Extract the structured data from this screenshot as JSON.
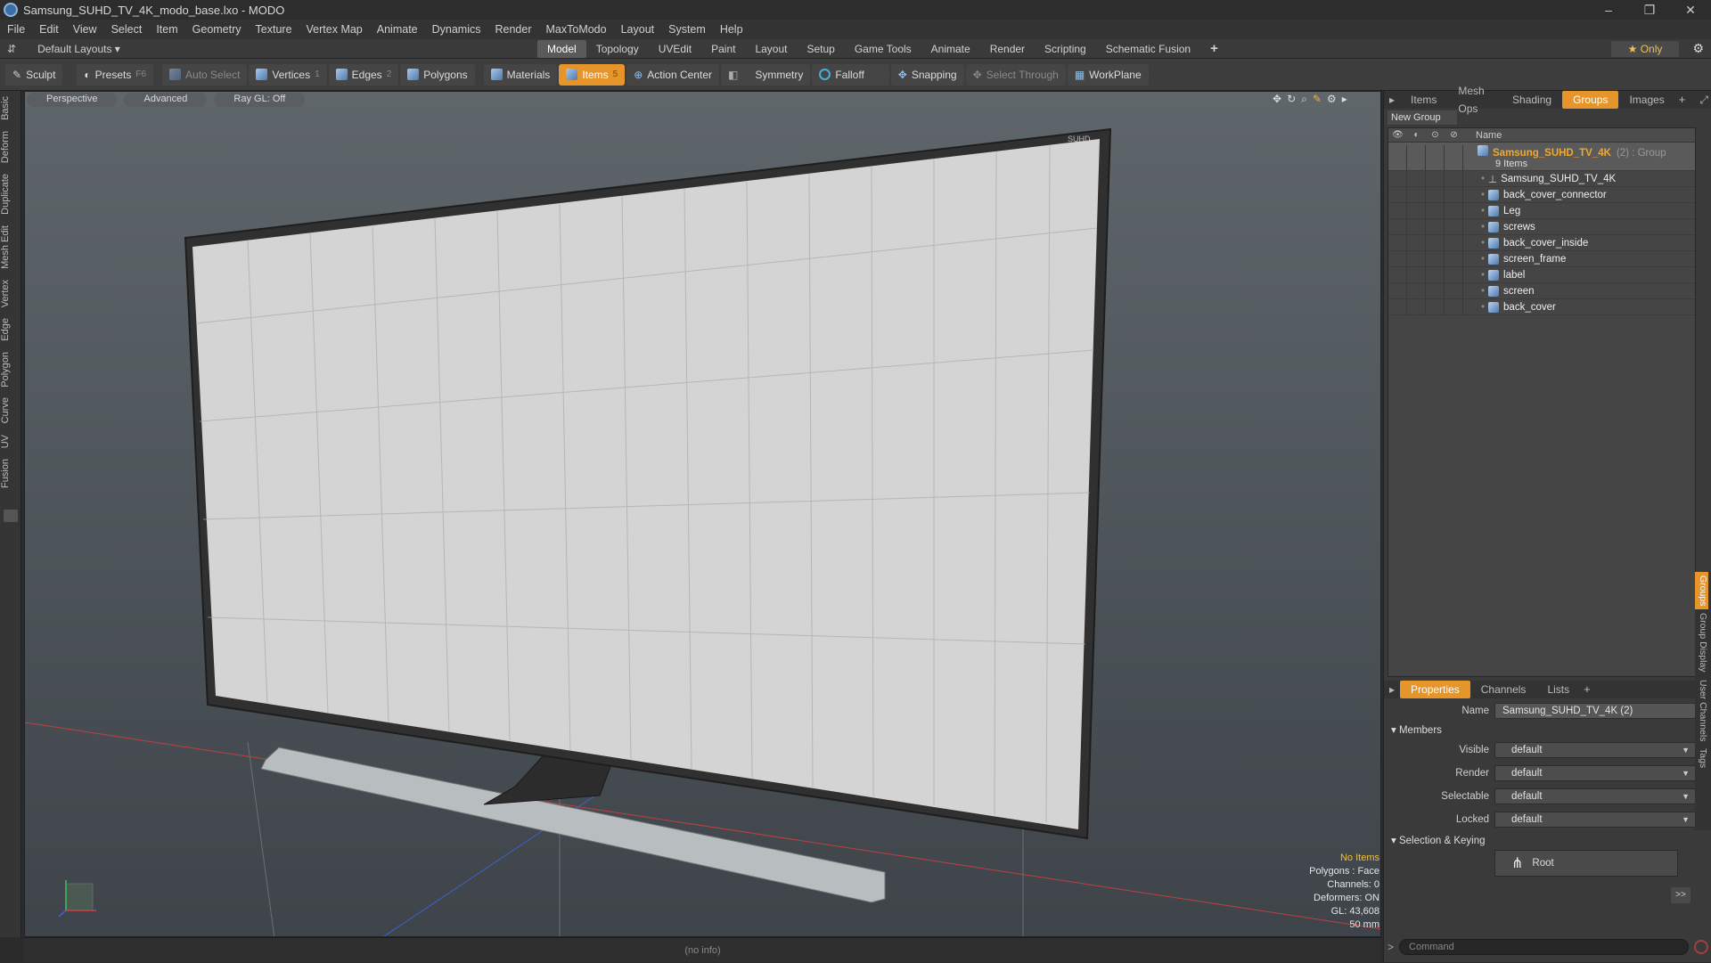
{
  "window": {
    "title": "Samsung_SUHD_TV_4K_modo_base.lxo - MODO",
    "controls": [
      "–",
      "❐",
      "✕"
    ]
  },
  "menu": [
    "File",
    "Edit",
    "View",
    "Select",
    "Item",
    "Geometry",
    "Texture",
    "Vertex Map",
    "Animate",
    "Dynamics",
    "Render",
    "MaxToModo",
    "Layout",
    "System",
    "Help"
  ],
  "layout_bar": {
    "layouts_label": "Default Layouts ▾",
    "tabs": [
      "Model",
      "Topology",
      "UVEdit",
      "Paint",
      "Layout",
      "Setup",
      "Game Tools",
      "Animate",
      "Render",
      "Scripting",
      "Schematic Fusion"
    ],
    "active_tab": "Model",
    "add": "+",
    "only_label": "★  Only"
  },
  "toolbar": {
    "sculpt": "Sculpt",
    "presets": "Presets",
    "presets_key": "F6",
    "auto_select": "Auto Select",
    "vertices": "Vertices",
    "vertices_count": "1",
    "edges": "Edges",
    "edges_count": "2",
    "polygons": "Polygons",
    "materials": "Materials",
    "items": "Items",
    "items_count": "5",
    "action_center": "Action Center",
    "symmetry": "Symmetry",
    "falloff": "Falloff",
    "snapping": "Snapping",
    "select_through": "Select Through",
    "workplane": "WorkPlane"
  },
  "left_tabs": [
    "Basic",
    "Deform",
    "Duplicate",
    "Mesh Edit",
    "Vertex",
    "Edge",
    "Polygon",
    "Curve",
    "UV",
    "Fusion"
  ],
  "viewport": {
    "view_mode": "Perspective",
    "shading": "Advanced",
    "raygl": "Ray GL: Off",
    "tv_badge": "SUHD",
    "info": {
      "items": "No Items",
      "polygons": "Polygons : Face",
      "channels": "Channels: 0",
      "deformers": "Deformers: ON",
      "gl": "GL: 43,608",
      "lens": "50 mm"
    },
    "status": "(no info)"
  },
  "panel_tabs": [
    "Items",
    "Mesh Ops",
    "Shading",
    "Groups",
    "Images"
  ],
  "panel_active": "Groups",
  "groups": {
    "new_group": "New Group",
    "name_col": "Name",
    "group_name": "Samsung_SUHD_TV_4K",
    "group_tag": "(2) : Group",
    "group_count": "9 Items",
    "members": [
      "Samsung_SUHD_TV_4K",
      "back_cover_connector",
      "Leg",
      "screws",
      "back_cover_inside",
      "screen_frame",
      "label",
      "screen",
      "back_cover"
    ]
  },
  "properties": {
    "tabs": [
      "Properties",
      "Channels",
      "Lists"
    ],
    "active": "Properties",
    "name_label": "Name",
    "name_value": "Samsung_SUHD_TV_4K (2)",
    "members_section": "Members",
    "visible_label": "Visible",
    "visible_value": "default",
    "render_label": "Render",
    "render_value": "default",
    "selectable_label": "Selectable",
    "selectable_value": "default",
    "locked_label": "Locked",
    "locked_value": "default",
    "selection_section": "Selection & Keying",
    "root_label": "Root",
    "more": ">>",
    "side_tabs": [
      "Groups",
      "Group Display",
      "User Channels",
      "Tags"
    ]
  },
  "command": {
    "prompt": ">",
    "placeholder": "Command"
  }
}
